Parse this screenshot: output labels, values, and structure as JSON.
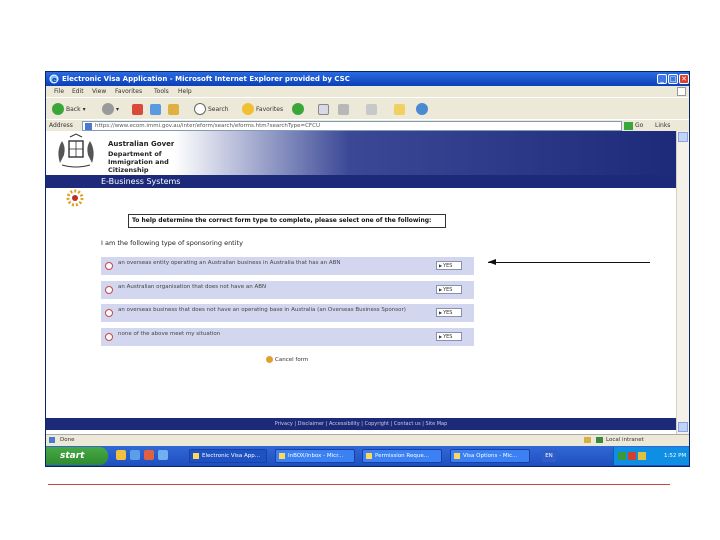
{
  "window": {
    "title": "Electronic Visa Application - Microsoft Internet Explorer provided by CSC",
    "controls": [
      "_",
      "□",
      "✕"
    ]
  },
  "menu": [
    "File",
    "Edit",
    "View",
    "Favorites",
    "Tools",
    "Help"
  ],
  "toolbar": {
    "back": "Back",
    "search": "Search",
    "favorites": "Favorites"
  },
  "address": {
    "label": "Address",
    "url": "https://www.ecom.immi.gov.au/inter/eform/search/eforms.htm?searchType=CFCU",
    "go": "Go",
    "links": "Links"
  },
  "header": {
    "government": "Australian Government",
    "department": "Department of Immigration and Citizenship",
    "section": "E-Business Systems"
  },
  "form": {
    "instruction": "To help determine the correct form type to complete, please select one of the following:",
    "heading": "I am the following type of sponsoring entity",
    "options": [
      {
        "text": "an overseas entity operating an Australian business in Australia that has an ABN",
        "button": "YES"
      },
      {
        "text": "an Australian organisation that does not have an ABN",
        "button": "YES"
      },
      {
        "text": "an overseas business that does not have an operating base in Australia (an Overseas Business Sponsor)",
        "button": "YES"
      },
      {
        "text": "none of the above meet my situation",
        "button": "YES"
      }
    ],
    "cancel": "Cancel form"
  },
  "footer": "Privacy | Disclaimer | Accessibility | Copyright | Contact us | Site Map",
  "status": {
    "left": "Done",
    "zone": "Local intranet"
  },
  "taskbar": {
    "start": "start",
    "tasks": [
      "Electronic Visa App...",
      "InBOX/Inbox - Micr...",
      "Permission Reque...",
      "Visa Options - Mic..."
    ],
    "lang": "EN",
    "clock": "1:52 PM"
  }
}
